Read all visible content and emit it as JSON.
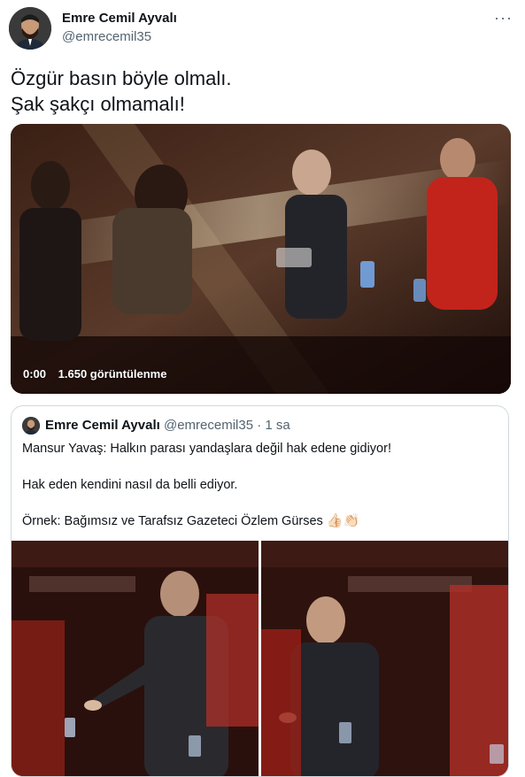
{
  "author": {
    "name": "Emre Cemil Ayvalı",
    "handle": "@emrecemil35"
  },
  "more_label": "···",
  "tweet": {
    "lines": [
      "Özgür basın böyle olmalı.",
      "Şak şakçı olmamalı!"
    ]
  },
  "video": {
    "time": "0:00",
    "views": "1.650 görüntülenme"
  },
  "quoted": {
    "name": "Emre Cemil Ayvalı",
    "handle": "@emrecemil35",
    "separator": "·",
    "time": "1 sa",
    "text_line1": "Mansur Yavaş: Halkın parası yandaşlara değil hak edene gidiyor!",
    "text_line2": "Hak eden kendini nasıl da belli ediyor.",
    "text_line3": "Örnek: Bağımsız ve Tarafsız Gazeteci Özlem Gürses",
    "emojis": "👍🏻👏🏻"
  },
  "icons": {
    "avatar": "profile-photo",
    "more": "more-horizontal-icon"
  }
}
